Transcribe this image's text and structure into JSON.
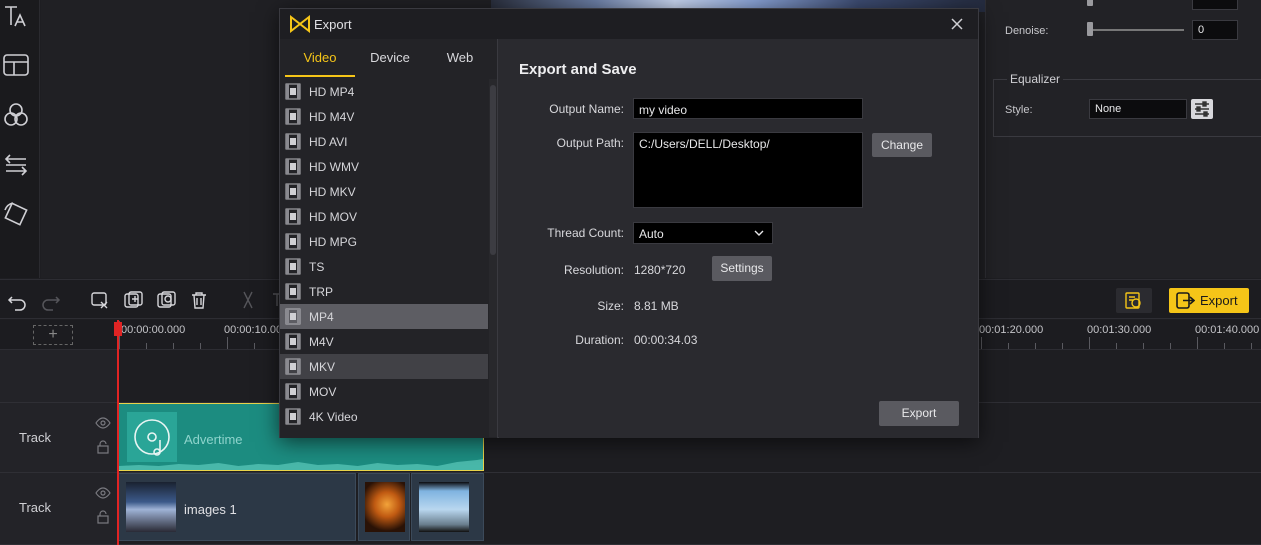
{
  "dialog": {
    "title": "Export",
    "tabs": [
      {
        "label": "Video",
        "active": true
      },
      {
        "label": "Device",
        "active": false
      },
      {
        "label": "Web",
        "active": false
      }
    ],
    "formats": [
      {
        "label": "HD MP4",
        "state": "normal"
      },
      {
        "label": "HD M4V",
        "state": "normal"
      },
      {
        "label": "HD AVI",
        "state": "normal"
      },
      {
        "label": "HD WMV",
        "state": "normal"
      },
      {
        "label": "HD MKV",
        "state": "normal"
      },
      {
        "label": "HD MOV",
        "state": "normal"
      },
      {
        "label": "HD MPG",
        "state": "normal"
      },
      {
        "label": "TS",
        "state": "normal"
      },
      {
        "label": "TRP",
        "state": "normal"
      },
      {
        "label": "MP4",
        "state": "selected"
      },
      {
        "label": "M4V",
        "state": "normal"
      },
      {
        "label": "MKV",
        "state": "hover"
      },
      {
        "label": "MOV",
        "state": "normal"
      },
      {
        "label": "4K Video",
        "state": "normal"
      }
    ],
    "heading": "Export and Save",
    "output_name_label": "Output Name:",
    "output_name_value": "my video",
    "output_path_label": "Output Path:",
    "output_path_value": "C:/Users/DELL/Desktop/",
    "change_label": "Change",
    "thread_label": "Thread Count:",
    "thread_value": "Auto",
    "resolution_label": "Resolution:",
    "resolution_value": "1280*720",
    "settings_label": "Settings",
    "size_label": "Size:",
    "size_value": "8.81 MB",
    "duration_label": "Duration:",
    "duration_value": "00:00:34.03",
    "export_label": "Export"
  },
  "right_panel": {
    "denoise_label": "Denoise:",
    "denoise_value": "0",
    "equalizer_title": "Equalizer",
    "style_label": "Style:",
    "style_value": "None"
  },
  "toolbar": {
    "export_label": "Export"
  },
  "ruler": {
    "times": [
      "00:00:00.000",
      "00:00:10.00",
      "00:01:20.000",
      "00:01:30.000",
      "00:01:40.000"
    ]
  },
  "tracks": [
    {
      "label": "Track",
      "clip_name": "Advertime"
    },
    {
      "label": "Track",
      "clip_name": "images 1"
    }
  ],
  "colors": {
    "accent": "#f5c518",
    "audio_clip": "#1c8c80",
    "playhead": "#e02424"
  }
}
